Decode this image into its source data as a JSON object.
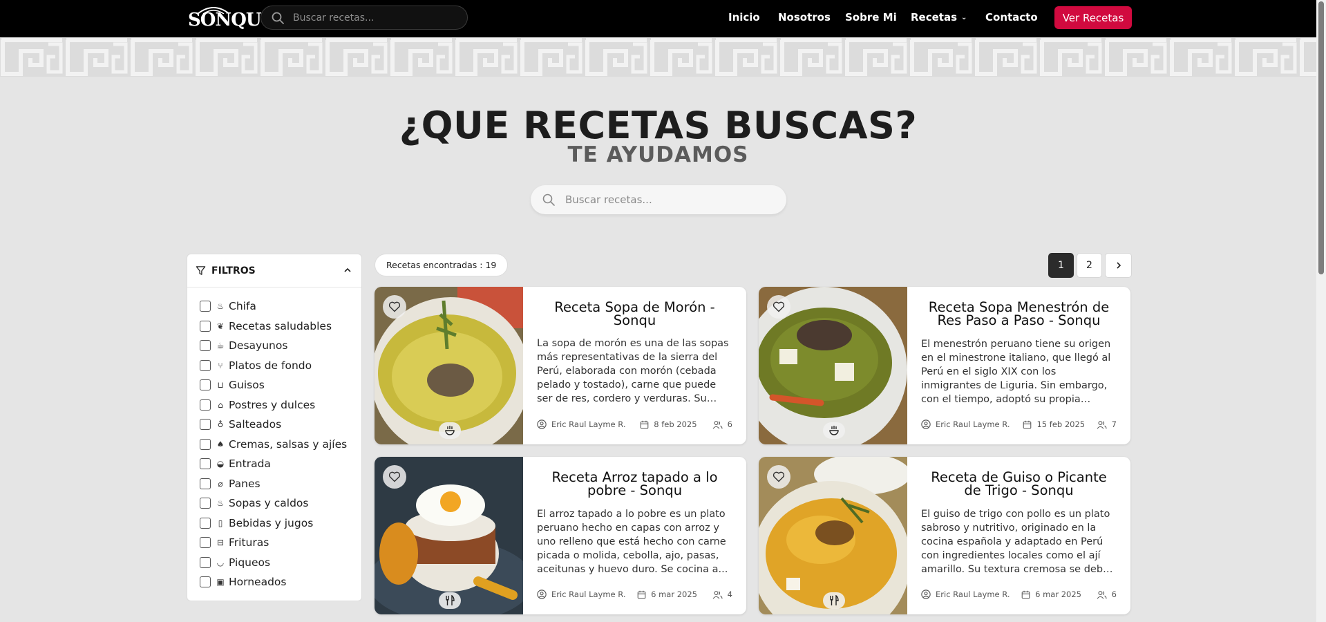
{
  "header": {
    "logo_text": "SONQU",
    "search_placeholder": "Buscar recetas...",
    "nav": [
      "Inicio",
      "Nosotros",
      "Sobre Mi",
      "Recetas",
      "Contacto"
    ],
    "cta_label": "Ver Recetas",
    "cta_color": "#d10a3f"
  },
  "hero": {
    "title": "¿QUE RECETAS BUSCAS?",
    "subtitle": "TE AYUDAMOS",
    "search_placeholder": "Buscar recetas..."
  },
  "filters": {
    "title": "FILTROS",
    "items": [
      {
        "label": "Chifa",
        "icon": "wok-icon"
      },
      {
        "label": "Recetas saludables",
        "icon": "leaf-icon"
      },
      {
        "label": "Desayunos",
        "icon": "coffee-cup-icon"
      },
      {
        "label": "Platos de fondo",
        "icon": "utensils-icon"
      },
      {
        "label": "Guisos",
        "icon": "cooking-pot-icon"
      },
      {
        "label": "Postres y dulces",
        "icon": "cake-icon"
      },
      {
        "label": "Salteados",
        "icon": "flame-icon"
      },
      {
        "label": "Cremas, salsas y ajíes",
        "icon": "chili-icon"
      },
      {
        "label": "Entrada",
        "icon": "salad-icon"
      },
      {
        "label": "Panes",
        "icon": "bread-icon"
      },
      {
        "label": "Sopas y caldos",
        "icon": "soup-icon"
      },
      {
        "label": "Bebidas y jugos",
        "icon": "cup-icon"
      },
      {
        "label": "Frituras",
        "icon": "fryer-icon"
      },
      {
        "label": "Piqueos",
        "icon": "bowl-icon"
      },
      {
        "label": "Horneados",
        "icon": "oven-icon"
      }
    ]
  },
  "results": {
    "count_label": "Recetas encontradas : 19",
    "pages": [
      "1",
      "2"
    ],
    "current_page": "1"
  },
  "recipes": [
    {
      "title": "Receta Sopa de Morón - Sonqu",
      "description": "La sopa de morón es una de las sopas más representativas de la sierra del Perú, elaborada con morón (cebada pelado y tostado), carne que puede ser de res, cordero y verduras. Su sabor...",
      "author": "Eric Raul Layme R.",
      "date": "8 feb 2025",
      "servings": "6",
      "category_icon": "soup-icon"
    },
    {
      "title": "Receta Sopa Menestrón de Res Paso a Paso - Sonqu",
      "description": "El menestrón peruano tiene su origen en el minestrone italiano, que llegó al Perú en el siglo XIX con los inmigrantes de Liguria. Sin embargo, con el tiempo, adoptó su propia identidad gracias a...",
      "author": "Eric Raul Layme R.",
      "date": "15 feb 2025",
      "servings": "7",
      "category_icon": "soup-icon"
    },
    {
      "title": "Receta Arroz tapado a lo pobre - Sonqu",
      "description": "El arroz tapado a lo pobre es un plato peruano hecho en capas con arroz y uno relleno que está hecho con carne picada o molida, cebolla, ajo, pasas, aceitunas y huevo duro. Se cocina a...",
      "author": "Eric Raul Layme R.",
      "date": "6 mar 2025",
      "servings": "4",
      "category_icon": "utensils-icon"
    },
    {
      "title": "Receta de Guiso o Picante de Trigo - Sonqu",
      "description": "El guiso de trigo con pollo es un plato sabroso y nutritivo, originado en la cocina española y adaptado en Perú con ingredientes locales como el ají amarillo. Su textura cremosa se debe a...",
      "author": "Eric Raul Layme R.",
      "date": "6 mar 2025",
      "servings": "6",
      "category_icon": "utensils-icon"
    }
  ]
}
